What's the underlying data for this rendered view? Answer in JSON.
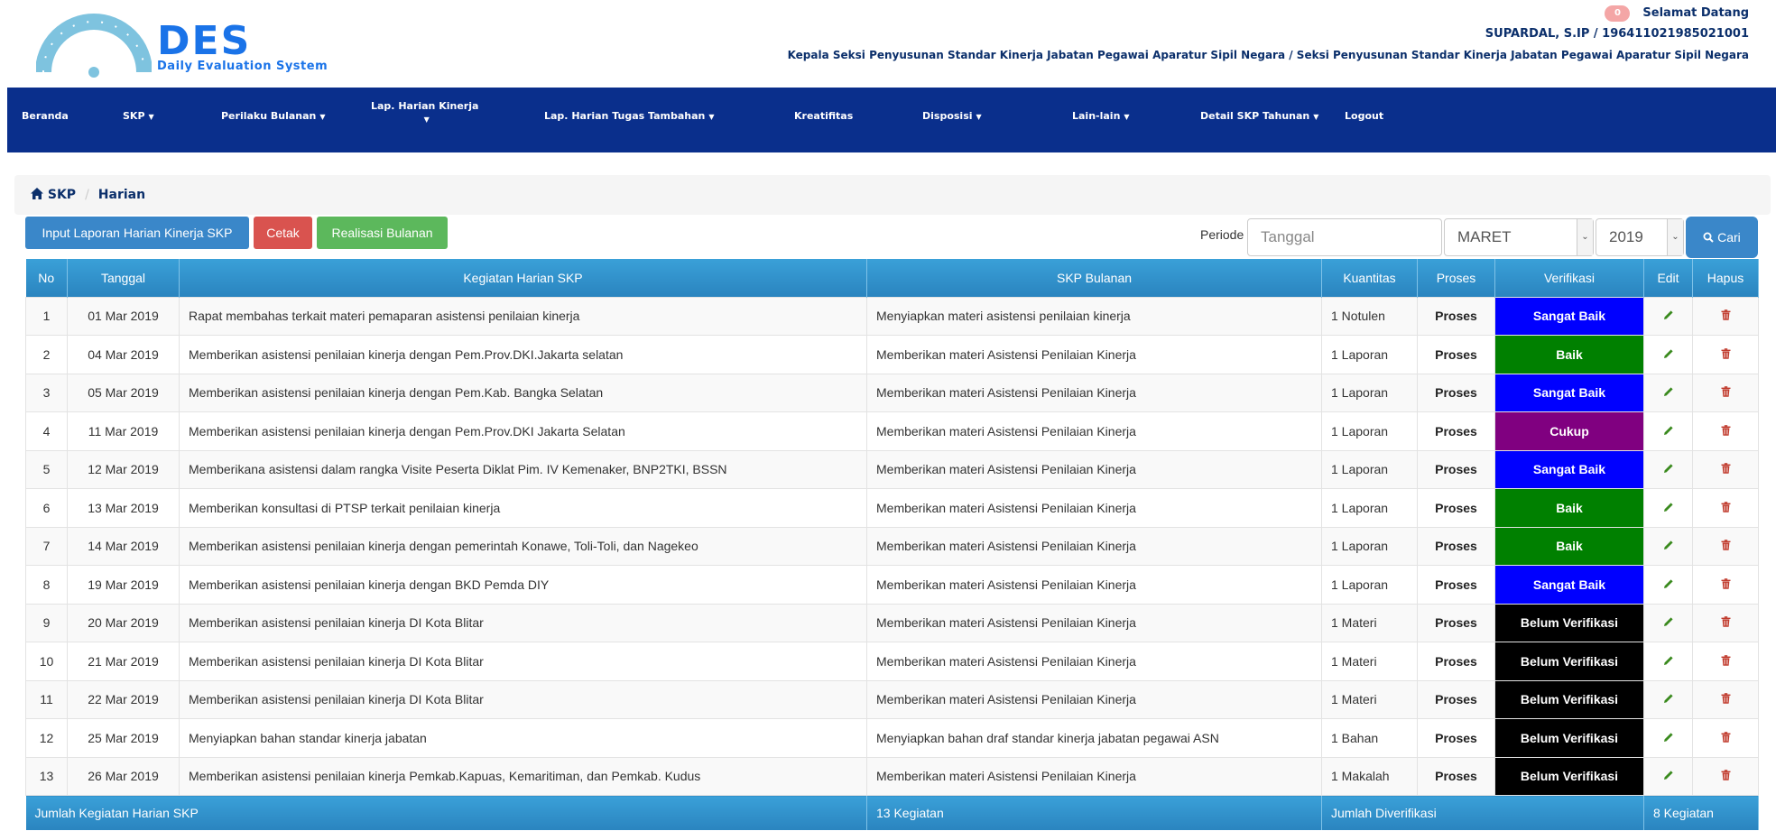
{
  "header": {
    "logo_text": "DES",
    "logo_sub": "Daily Evaluation System",
    "notif_count": "0",
    "welcome": "Selamat Datang",
    "user": "SUPARDAL, S.IP / 196411021985021001",
    "position": "Kepala Seksi Penyusunan Standar Kinerja Jabatan Pegawai Aparatur Sipil Negara / Seksi Penyusunan Standar Kinerja Jabatan Pegawai Aparatur Sipil Negara"
  },
  "nav": [
    {
      "label": "Beranda",
      "caret": false
    },
    {
      "label": "SKP",
      "caret": true
    },
    {
      "label": "Perilaku Bulanan",
      "caret": true
    },
    {
      "label": "Lap. Harian Kinerja",
      "caret": true
    },
    {
      "label": "Lap. Harian Tugas Tambahan",
      "caret": true
    },
    {
      "label": "Kreatifitas",
      "caret": false
    },
    {
      "label": "Disposisi",
      "caret": true
    },
    {
      "label": "Lain-lain",
      "caret": true
    },
    {
      "label": "Detail SKP Tahunan",
      "caret": true
    },
    {
      "label": "Logout",
      "caret": false
    }
  ],
  "breadcrumb": {
    "home": "SKP",
    "current": "Harian"
  },
  "toolbar": {
    "input_label": "Input Laporan Harian Kinerja SKP",
    "cetak_label": "Cetak",
    "realisasi_label": "Realisasi Bulanan",
    "periode_label": "Periode",
    "tanggal_placeholder": "Tanggal",
    "bulan_value": "MARET",
    "tahun_value": "2019",
    "cari_label": "Cari"
  },
  "table": {
    "columns": [
      "No",
      "Tanggal",
      "Kegiatan Harian SKP",
      "SKP Bulanan",
      "Kuantitas",
      "Proses",
      "Verifikasi",
      "Edit",
      "Hapus"
    ],
    "rows": [
      {
        "no": "1",
        "tanggal": "01 Mar 2019",
        "kegiatan": "Rapat membahas terkait materi pemaparan asistensi penilaian kinerja",
        "skp": "Menyiapkan materi asistensi penilaian kinerja",
        "kuantitas": "1 Notulen",
        "proses": "Proses",
        "verifikasi": "Sangat Baik",
        "status": "sangat"
      },
      {
        "no": "2",
        "tanggal": "04 Mar 2019",
        "kegiatan": "Memberikan asistensi penilaian kinerja dengan Pem.Prov.DKI.Jakarta selatan",
        "skp": "Memberikan materi Asistensi Penilaian Kinerja",
        "kuantitas": "1 Laporan",
        "proses": "Proses",
        "verifikasi": "Baik",
        "status": "baik"
      },
      {
        "no": "3",
        "tanggal": "05 Mar 2019",
        "kegiatan": "Memberikan asistensi penilaian kinerja dengan Pem.Kab. Bangka Selatan",
        "skp": "Memberikan materi Asistensi Penilaian Kinerja",
        "kuantitas": "1 Laporan",
        "proses": "Proses",
        "verifikasi": "Sangat Baik",
        "status": "sangat"
      },
      {
        "no": "4",
        "tanggal": "11 Mar 2019",
        "kegiatan": "Memberikan asistensi penilaian kinerja dengan Pem.Prov.DKI Jakarta Selatan",
        "skp": "Memberikan materi Asistensi Penilaian Kinerja",
        "kuantitas": "1 Laporan",
        "proses": "Proses",
        "verifikasi": "Cukup",
        "status": "cukup"
      },
      {
        "no": "5",
        "tanggal": "12 Mar 2019",
        "kegiatan": "Memberikana asistensi dalam rangka Visite Peserta Diklat Pim. IV Kemenaker, BNP2TKI, BSSN",
        "skp": "Memberikan materi Asistensi Penilaian Kinerja",
        "kuantitas": "1 Laporan",
        "proses": "Proses",
        "verifikasi": "Sangat Baik",
        "status": "sangat"
      },
      {
        "no": "6",
        "tanggal": "13 Mar 2019",
        "kegiatan": "Memberikan konsultasi di PTSP terkait penilaian kinerja",
        "skp": "Memberikan materi Asistensi Penilaian Kinerja",
        "kuantitas": "1 Laporan",
        "proses": "Proses",
        "verifikasi": "Baik",
        "status": "baik"
      },
      {
        "no": "7",
        "tanggal": "14 Mar 2019",
        "kegiatan": "Memberikan asistensi penilaian kinerja dengan pemerintah Konawe, Toli-Toli, dan Nagekeo",
        "skp": "Memberikan materi Asistensi Penilaian Kinerja",
        "kuantitas": "1 Laporan",
        "proses": "Proses",
        "verifikasi": "Baik",
        "status": "baik"
      },
      {
        "no": "8",
        "tanggal": "19 Mar 2019",
        "kegiatan": "Memberikan asistensi penilaian kinerja dengan BKD Pemda DIY",
        "skp": "Memberikan materi Asistensi Penilaian Kinerja",
        "kuantitas": "1 Laporan",
        "proses": "Proses",
        "verifikasi": "Sangat Baik",
        "status": "sangat"
      },
      {
        "no": "9",
        "tanggal": "20 Mar 2019",
        "kegiatan": "Memberikan asistensi penilaian kinerja DI Kota Blitar",
        "skp": "Memberikan materi Asistensi Penilaian Kinerja",
        "kuantitas": "1 Materi",
        "proses": "Proses",
        "verifikasi": "Belum Verifikasi",
        "status": "belum"
      },
      {
        "no": "10",
        "tanggal": "21 Mar 2019",
        "kegiatan": "Memberikan asistensi penilaian kinerja DI Kota Blitar",
        "skp": "Memberikan materi Asistensi Penilaian Kinerja",
        "kuantitas": "1 Materi",
        "proses": "Proses",
        "verifikasi": "Belum Verifikasi",
        "status": "belum"
      },
      {
        "no": "11",
        "tanggal": "22 Mar 2019",
        "kegiatan": "Memberikan asistensi penilaian kinerja DI Kota Blitar",
        "skp": "Memberikan materi Asistensi Penilaian Kinerja",
        "kuantitas": "1 Materi",
        "proses": "Proses",
        "verifikasi": "Belum Verifikasi",
        "status": "belum"
      },
      {
        "no": "12",
        "tanggal": "25 Mar 2019",
        "kegiatan": "Menyiapkan bahan standar kinerja jabatan",
        "skp": "Menyiapkan bahan draf standar kinerja jabatan pegawai ASN",
        "kuantitas": "1 Bahan",
        "proses": "Proses",
        "verifikasi": "Belum Verifikasi",
        "status": "belum"
      },
      {
        "no": "13",
        "tanggal": "26 Mar 2019",
        "kegiatan": "Memberikan asistensi penilaian kinerja Pemkab.Kapuas, Kemaritiman, dan Pemkab. Kudus",
        "skp": "Memberikan materi Asistensi Penilaian Kinerja",
        "kuantitas": "1 Makalah",
        "proses": "Proses",
        "verifikasi": "Belum Verifikasi",
        "status": "belum"
      }
    ],
    "footer": {
      "label": "Jumlah Kegiatan Harian SKP",
      "total": "13 Kegiatan",
      "verified_label": "Jumlah Diverifikasi",
      "verified_total": "8 Kegiatan"
    }
  },
  "colors": {
    "navbar": "#0a2f8c",
    "sangat_baik": "#0000ff",
    "baik": "#008000",
    "cukup": "#800080",
    "belum": "#000000",
    "edit_icon": "#3a8a1e",
    "delete_icon": "#c0392b"
  }
}
